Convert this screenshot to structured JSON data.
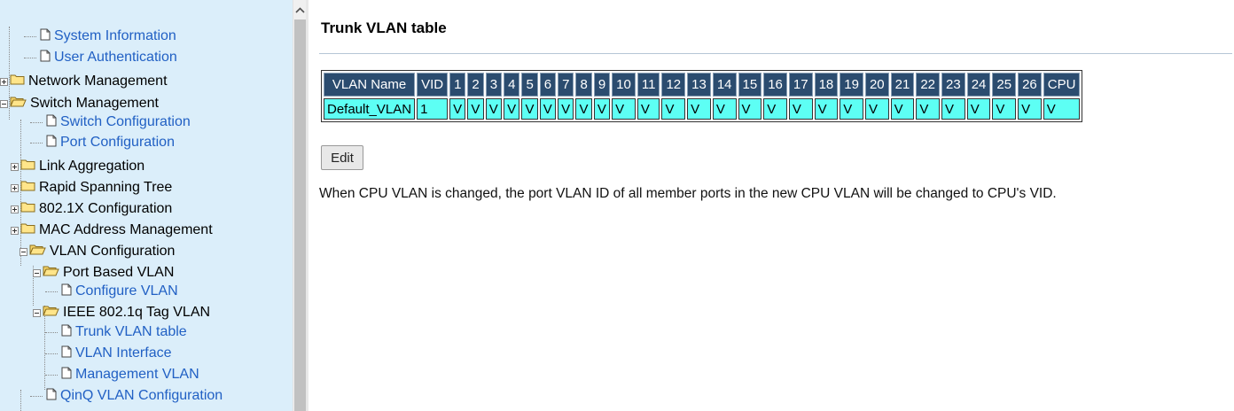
{
  "tree": {
    "items": [
      {
        "label": "System Information",
        "type": "page"
      },
      {
        "label": "User Authentication",
        "type": "page"
      },
      {
        "label": "Network Management",
        "type": "folder-collapsed"
      },
      {
        "label": "Switch Management",
        "type": "folder-expanded"
      },
      {
        "label": "Switch Configuration",
        "type": "page"
      },
      {
        "label": "Port Configuration",
        "type": "page"
      },
      {
        "label": "Link Aggregation",
        "type": "folder-collapsed"
      },
      {
        "label": "Rapid Spanning Tree",
        "type": "folder-collapsed"
      },
      {
        "label": "802.1X Configuration",
        "type": "folder-collapsed"
      },
      {
        "label": "MAC Address Management",
        "type": "folder-collapsed"
      },
      {
        "label": "VLAN Configuration",
        "type": "folder-expanded"
      },
      {
        "label": "Port Based VLAN",
        "type": "folder-expanded"
      },
      {
        "label": "Configure VLAN",
        "type": "page"
      },
      {
        "label": "IEEE 802.1q Tag VLAN",
        "type": "folder-expanded"
      },
      {
        "label": "Trunk VLAN table",
        "type": "page"
      },
      {
        "label": "VLAN Interface",
        "type": "page"
      },
      {
        "label": "Management VLAN",
        "type": "page"
      },
      {
        "label": "QinQ VLAN Configuration",
        "type": "page"
      }
    ]
  },
  "scrollbar": {
    "up_arrow": "chevron-up-icon"
  },
  "main": {
    "title": "Trunk VLAN table",
    "table": {
      "headers": [
        "VLAN Name",
        "VID",
        "1",
        "2",
        "3",
        "4",
        "5",
        "6",
        "7",
        "8",
        "9",
        "10",
        "11",
        "12",
        "13",
        "14",
        "15",
        "16",
        "17",
        "18",
        "19",
        "20",
        "21",
        "22",
        "23",
        "24",
        "25",
        "26",
        "CPU"
      ],
      "rows": [
        [
          "Default_VLAN",
          "1",
          "V",
          "V",
          "V",
          "V",
          "V",
          "V",
          "V",
          "V",
          "V",
          "V",
          "V",
          "V",
          "V",
          "V",
          "V",
          "V",
          "V",
          "V",
          "V",
          "V",
          "V",
          "V",
          "V",
          "V",
          "V",
          "V",
          "V"
        ]
      ]
    },
    "edit_label": "Edit",
    "note": "When CPU VLAN is changed, the port VLAN ID of all member ports in the new CPU VLAN will be changed to CPU's VID."
  },
  "colors": {
    "tree_bg": "#dbeefa",
    "link": "#2160c4",
    "header_bg": "#2b4c6f",
    "cell_bg": "#5dfff4"
  }
}
